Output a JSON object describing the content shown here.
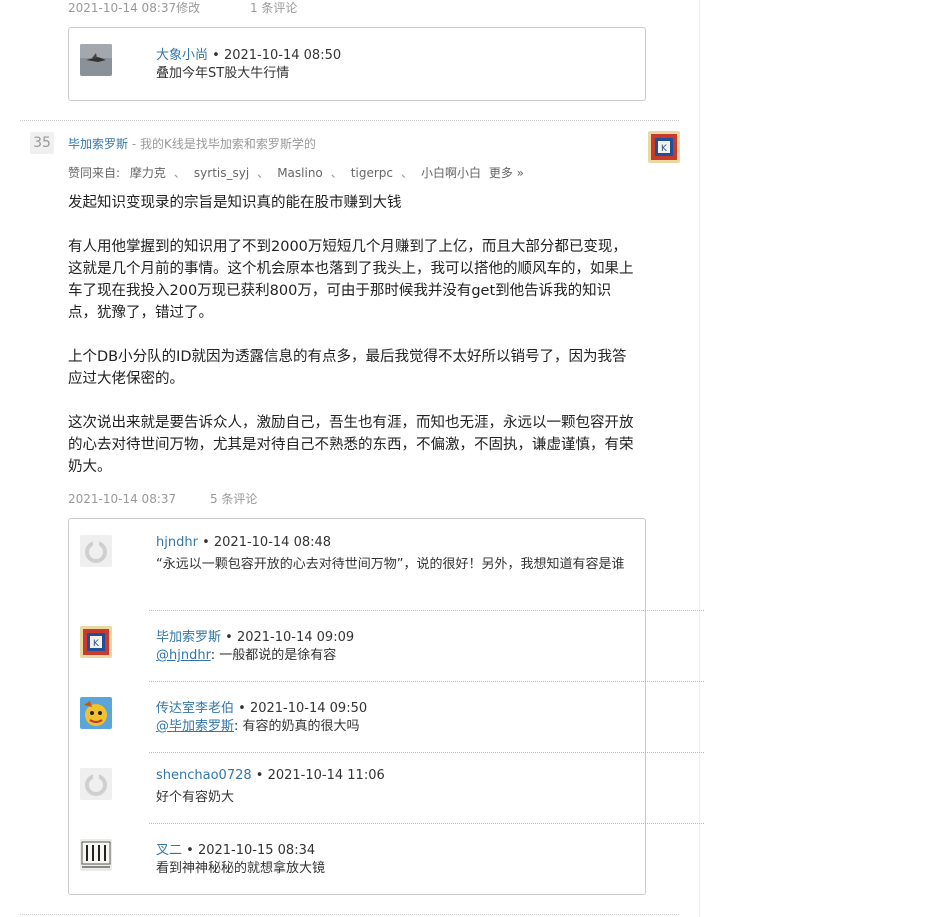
{
  "top_comment": {
    "time": "2021-10-14 08:37修改",
    "comment_count": "1 条评论",
    "reply": {
      "user": "大象小尚",
      "time": "2021-10-14 08:50",
      "text": "叠加今年ST股大牛行情"
    }
  },
  "post": {
    "floor": "35",
    "author": "毕加索罗斯",
    "signature": "我的K线是找毕加索和索罗斯学的",
    "likes_label": "赞同来自:",
    "likers": [
      "摩力克",
      "syrtis_syj",
      "Maslino",
      "tigerpc",
      "小白啊小白"
    ],
    "more": "更多 »",
    "paragraphs": [
      "发起知识变现录的宗旨是知识真的能在股市赚到大钱",
      "有人用他掌握到的知识用了不到2000万短短几个月赚到了上亿，而且大部分都已变现，这就是几个月前的事情。这个机会原本也落到了我头上，我可以搭他的顺风车的，如果上车了现在我投入200万现已获利800万，可由于那时候我并没有get到他告诉我的知识点，犹豫了，错过了。",
      "上个DB小分队的ID就因为透露信息的有点多，最后我觉得不太好所以销号了，因为我答应过大佬保密的。",
      "这次说出来就是要告诉众人，激励自己，吾生也有涯，而知也无涯，永远以一颗包容开放的心去对待世间万物，尤其是对待自己不熟悉的东西，不偏激，不固执，谦虚谨慎，有荣奶大。"
    ],
    "time": "2021-10-14 08:37",
    "comment_count": "5 条评论"
  },
  "comments": [
    {
      "user": "hjndhr",
      "time": "2021-10-14 08:48",
      "mention": "",
      "text": "“永远以一颗包容开放的心去对待世间万物”，说的很好！另外，我想知道有容是谁"
    },
    {
      "user": "毕加索罗斯",
      "time": "2021-10-14 09:09",
      "mention": "@hjndhr",
      "text": ": 一般都说的是徐有容"
    },
    {
      "user": "传达室李老伯",
      "time": "2021-10-14 09:50",
      "mention": "@毕加索罗斯",
      "text": ": 有容的奶真的很大吗"
    },
    {
      "user": "shenchao0728",
      "time": "2021-10-14 11:06",
      "mention": "",
      "text": "好个有容奶大"
    },
    {
      "user": "叉二",
      "time": "2021-10-15 08:34",
      "mention": "",
      "text": "看到神神秘秘的就想拿放大镜"
    }
  ],
  "bullet": "•",
  "separator": "、",
  "colors": {
    "link": "#3377aa",
    "meta": "#999999",
    "border": "#cccccc"
  }
}
